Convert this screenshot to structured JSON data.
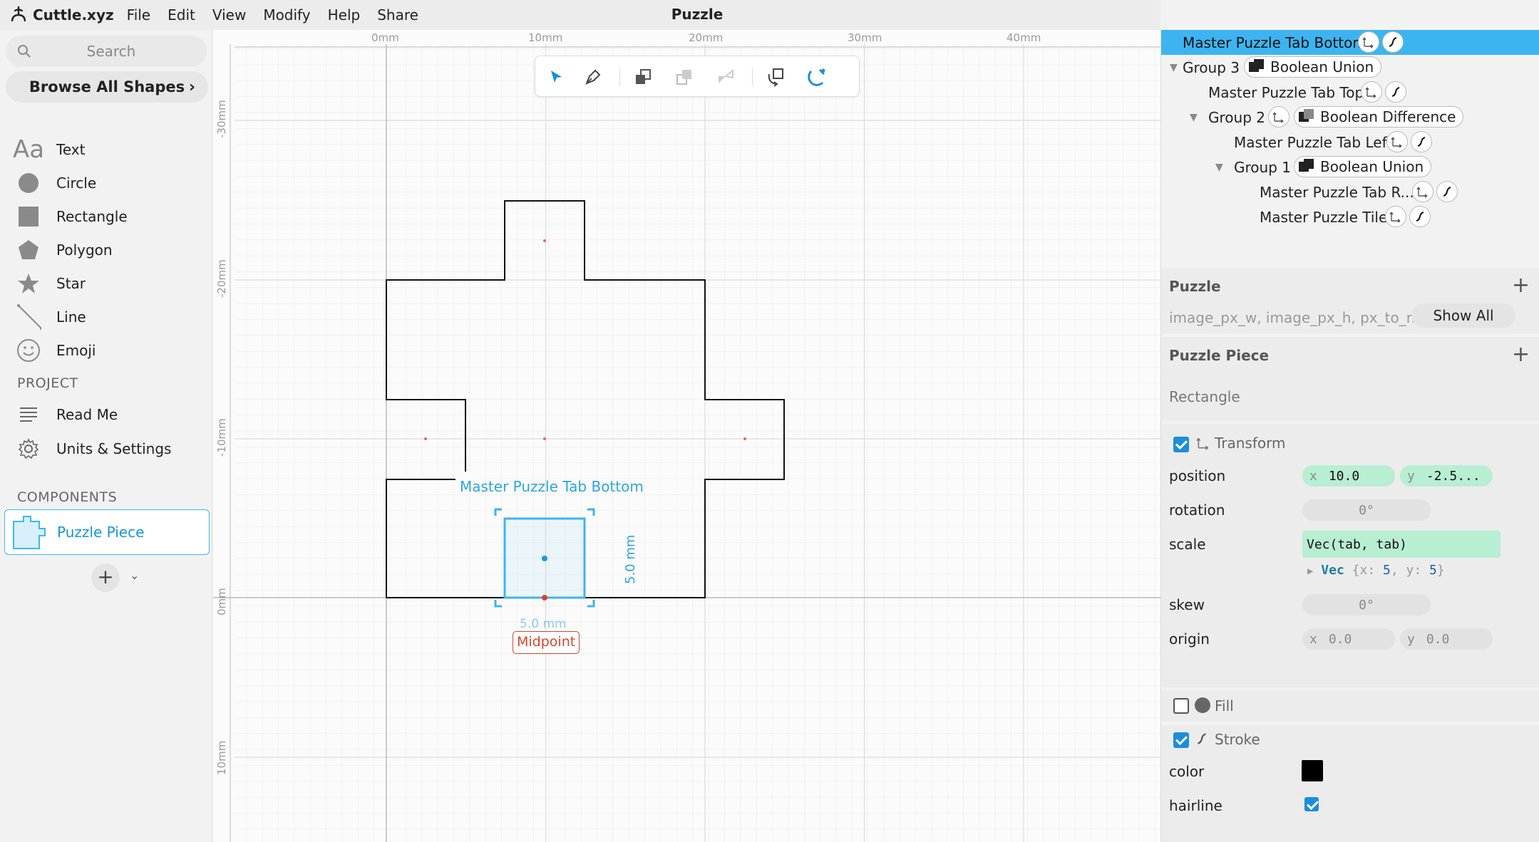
{
  "menubar": {
    "app_name": "Cuttle.xyz",
    "menu": [
      "File",
      "Edit",
      "View",
      "Modify",
      "Help",
      "Share"
    ],
    "document_title": "Puzzle"
  },
  "sidebar": {
    "search_placeholder": "Search",
    "browse_label": "Browse All Shapes",
    "shapes": [
      {
        "icon": "text-icon",
        "label": "Text"
      },
      {
        "icon": "circle-icon",
        "label": "Circle"
      },
      {
        "icon": "rectangle-icon",
        "label": "Rectangle"
      },
      {
        "icon": "polygon-icon",
        "label": "Polygon"
      },
      {
        "icon": "star-icon",
        "label": "Star"
      },
      {
        "icon": "line-icon",
        "label": "Line"
      },
      {
        "icon": "emoji-icon",
        "label": "Emoji"
      }
    ],
    "project_heading": "PROJECT",
    "project_items": [
      {
        "icon": "read-me-icon",
        "label": "Read Me"
      },
      {
        "icon": "gear-icon",
        "label": "Units & Settings"
      }
    ],
    "components_heading": "COMPONENTS",
    "components": [
      {
        "icon": "puzzle-piece-icon",
        "label": "Puzzle Piece"
      }
    ]
  },
  "canvas": {
    "ruler_x": [
      "0mm",
      "10mm",
      "20mm",
      "30mm",
      "40mm"
    ],
    "ruler_y": [
      "-30mm",
      "-20mm",
      "-10mm",
      "0mm",
      "10mm"
    ],
    "selection_label": "Master Puzzle Tab Bottom",
    "height_dimension": "5.0 mm",
    "width_dimension": "5.0 mm",
    "snap_tag": "Midpoint",
    "tools": [
      "select-tool-icon",
      "pen-tool-icon",
      "bring-forward-icon",
      "send-backward-icon",
      "flip-icon",
      "rotate-arrange-icon",
      "snap-magnet-icon"
    ]
  },
  "layers": [
    {
      "name": "Master Puzzle Tab Bottom",
      "selected": true
    },
    {
      "name": "Group 3",
      "op": "Boolean Union"
    },
    {
      "name": "Master Puzzle Tab Top"
    },
    {
      "name": "Group 2",
      "op": "Boolean Difference"
    },
    {
      "name": "Master Puzzle Tab Left"
    },
    {
      "name": "Group 1",
      "op": "Boolean Union"
    },
    {
      "name": "Master Puzzle Tab R..."
    },
    {
      "name": "Master Puzzle Tile"
    }
  ],
  "inspector": {
    "puzzle": {
      "title": "Puzzle",
      "params": "image_px_w, image_px_h, px_to_mm,...",
      "show_all": "Show All"
    },
    "puzzle_piece": {
      "title": "Puzzle Piece"
    },
    "shape_type": "Rectangle",
    "transform": {
      "label": "Transform",
      "enabled": true,
      "position": {
        "label": "position",
        "x_axis": "x",
        "x": "10.0",
        "y_axis": "y",
        "y": "-2.5..."
      },
      "rotation": {
        "label": "rotation",
        "value": "0°"
      },
      "scale": {
        "label": "scale",
        "value": "Vec(tab, tab)",
        "evaluated_type": "Vec",
        "evaluated_open": "{x:",
        "evaluated_x": "5",
        "evaluated_mid": ", y:",
        "evaluated_y": "5",
        "evaluated_close": "}"
      },
      "skew": {
        "label": "skew",
        "value": "0°"
      },
      "origin": {
        "label": "origin",
        "x_axis": "x",
        "x": "0.0",
        "y_axis": "y",
        "y": "0.0"
      }
    },
    "fill": {
      "label": "Fill",
      "enabled": false
    },
    "stroke": {
      "label": "Stroke",
      "enabled": true,
      "color_label": "color",
      "color": "#000000",
      "hairline_label": "hairline",
      "hairline": true
    }
  },
  "colors": {
    "accent": "#3db4f0",
    "selection": "#2ba6e0",
    "snap": "#d9442b",
    "expr_field": "#b8eed2"
  }
}
